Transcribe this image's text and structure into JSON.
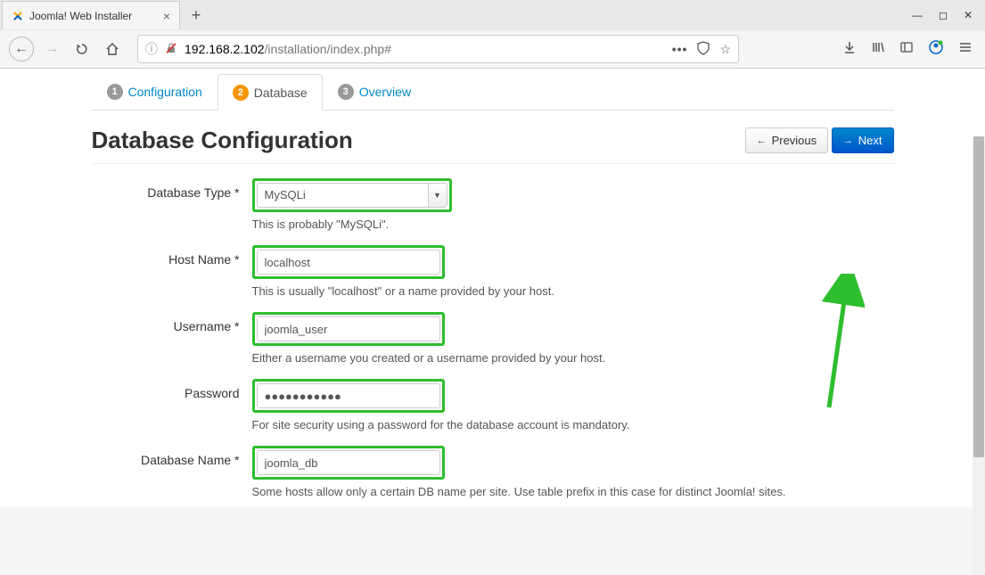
{
  "browser": {
    "tab_title": "Joomla! Web Installer",
    "url_domain": "192.168.2.102",
    "url_path": "/installation/index.php#"
  },
  "steps": [
    {
      "num": "1",
      "label": "Configuration"
    },
    {
      "num": "2",
      "label": "Database"
    },
    {
      "num": "3",
      "label": "Overview"
    }
  ],
  "page_title": "Database Configuration",
  "buttons": {
    "previous": "Previous",
    "next": "Next"
  },
  "form": {
    "db_type": {
      "label": "Database Type *",
      "value": "MySQLi",
      "help": "This is probably \"MySQLi\"."
    },
    "host": {
      "label": "Host Name *",
      "value": "localhost",
      "help": "This is usually \"localhost\" or a name provided by your host."
    },
    "username": {
      "label": "Username *",
      "value": "joomla_user",
      "help": "Either a username you created or a username provided by your host."
    },
    "password": {
      "label": "Password",
      "value": "●●●●●●●●●●●",
      "help": "For site security using a password for the database account is mandatory."
    },
    "dbname": {
      "label": "Database Name *",
      "value": "joomla_db",
      "help": "Some hosts allow only a certain DB name per site. Use table prefix in this case for distinct Joomla! sites."
    }
  }
}
